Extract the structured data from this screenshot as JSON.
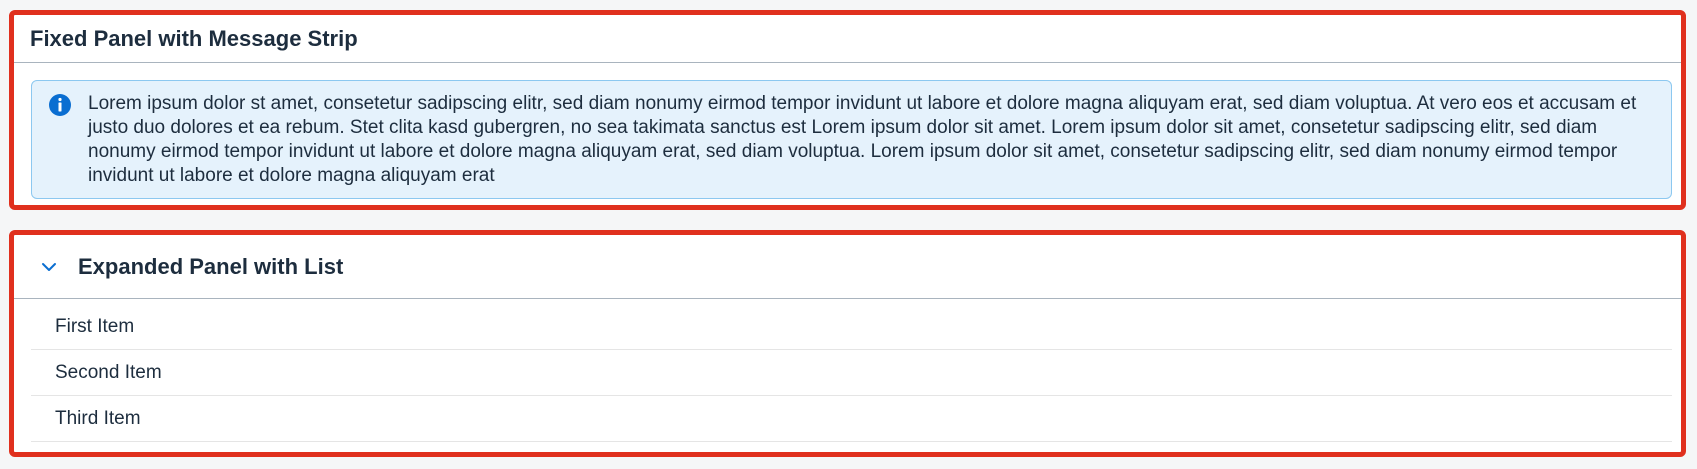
{
  "fixed_panel": {
    "title": "Fixed Panel with Message Strip",
    "message_strip": {
      "icon": "information-icon",
      "color": "#0a6ed1",
      "text": "Lorem ipsum dolor st amet, consetetur sadipscing elitr, sed diam nonumy eirmod tempor invidunt ut labore et dolore magna aliquyam erat, sed diam voluptua. At vero eos et accusam et justo duo dolores et ea rebum. Stet clita kasd gubergren, no sea takimata sanctus est Lorem ipsum dolor sit amet. Lorem ipsum dolor sit amet, consetetur sadipscing elitr, sed diam nonumy eirmod tempor invidunt ut labore et dolore magna aliquyam erat, sed diam voluptua. Lorem ipsum dolor sit amet, consetetur sadipscing elitr, sed diam nonumy eirmod tempor invidunt ut labore et dolore magna aliquyam erat"
    }
  },
  "expanded_panel": {
    "title": "Expanded Panel with List",
    "toggle_icon": "chevron-down-icon",
    "items": [
      {
        "label": "First Item"
      },
      {
        "label": "Second Item"
      },
      {
        "label": "Third Item"
      }
    ]
  },
  "colors": {
    "highlight_border": "#e0301e",
    "accent": "#0a6ed1",
    "strip_background": "#e5f2fc"
  }
}
